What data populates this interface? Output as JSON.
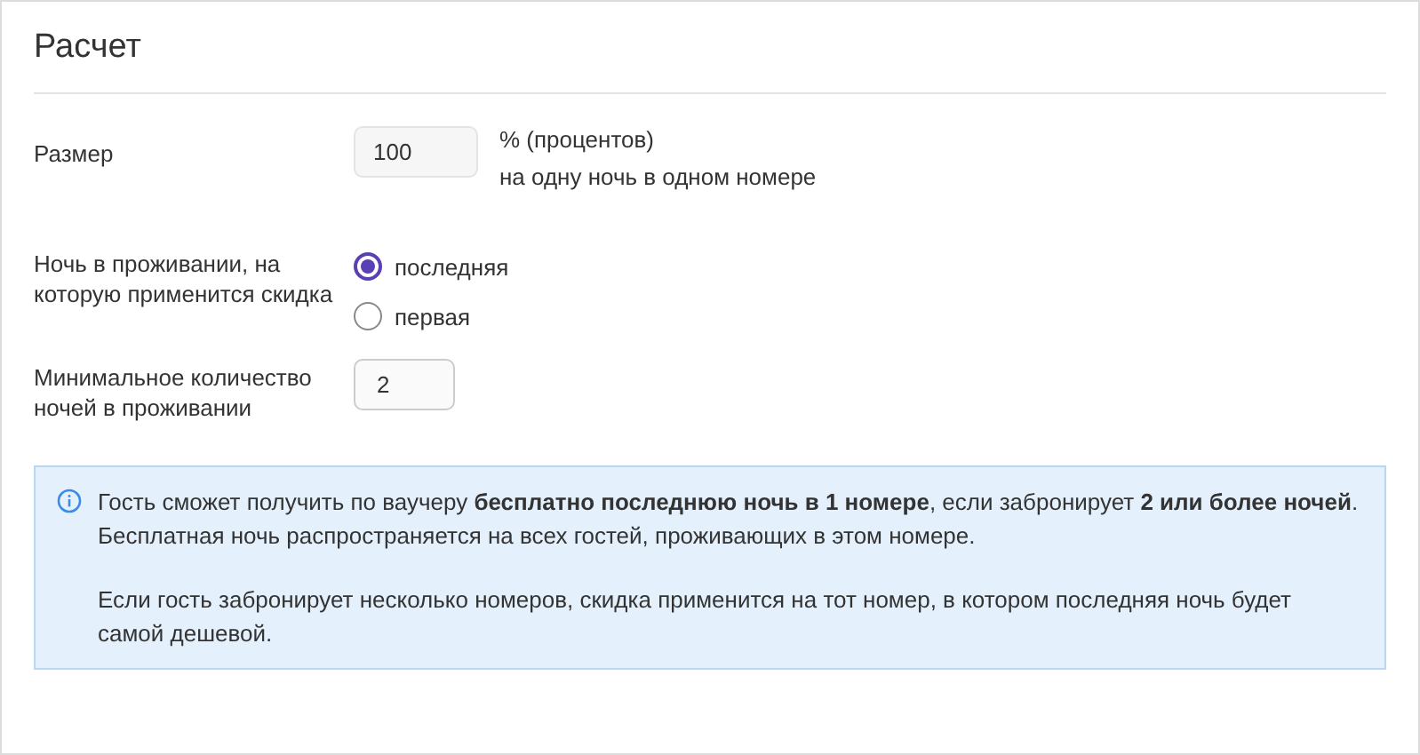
{
  "title": "Расчет",
  "size": {
    "label": "Размер",
    "value": "100",
    "unit": "% (процентов)",
    "note": "на одну ночь в одном номере"
  },
  "night": {
    "label": "Ночь в проживании, на которую применится скидка",
    "options": [
      {
        "label": "последняя",
        "selected": true
      },
      {
        "label": "первая",
        "selected": false
      }
    ]
  },
  "min_nights": {
    "label": "Минимальное количество ночей в проживании",
    "value": "2"
  },
  "info": {
    "paragraphs": [
      "Гость сможет получить по ваучеру **бесплатно последнюю ночь в 1 номере**, если забронирует **2 или более ночей**. Бесплатная ночь распространяется на всех гостей, проживающих в этом номере.",
      "Если гость забронирует несколько номеров, скидка применится на тот номер, в котором последняя ночь будет самой дешевой."
    ]
  }
}
